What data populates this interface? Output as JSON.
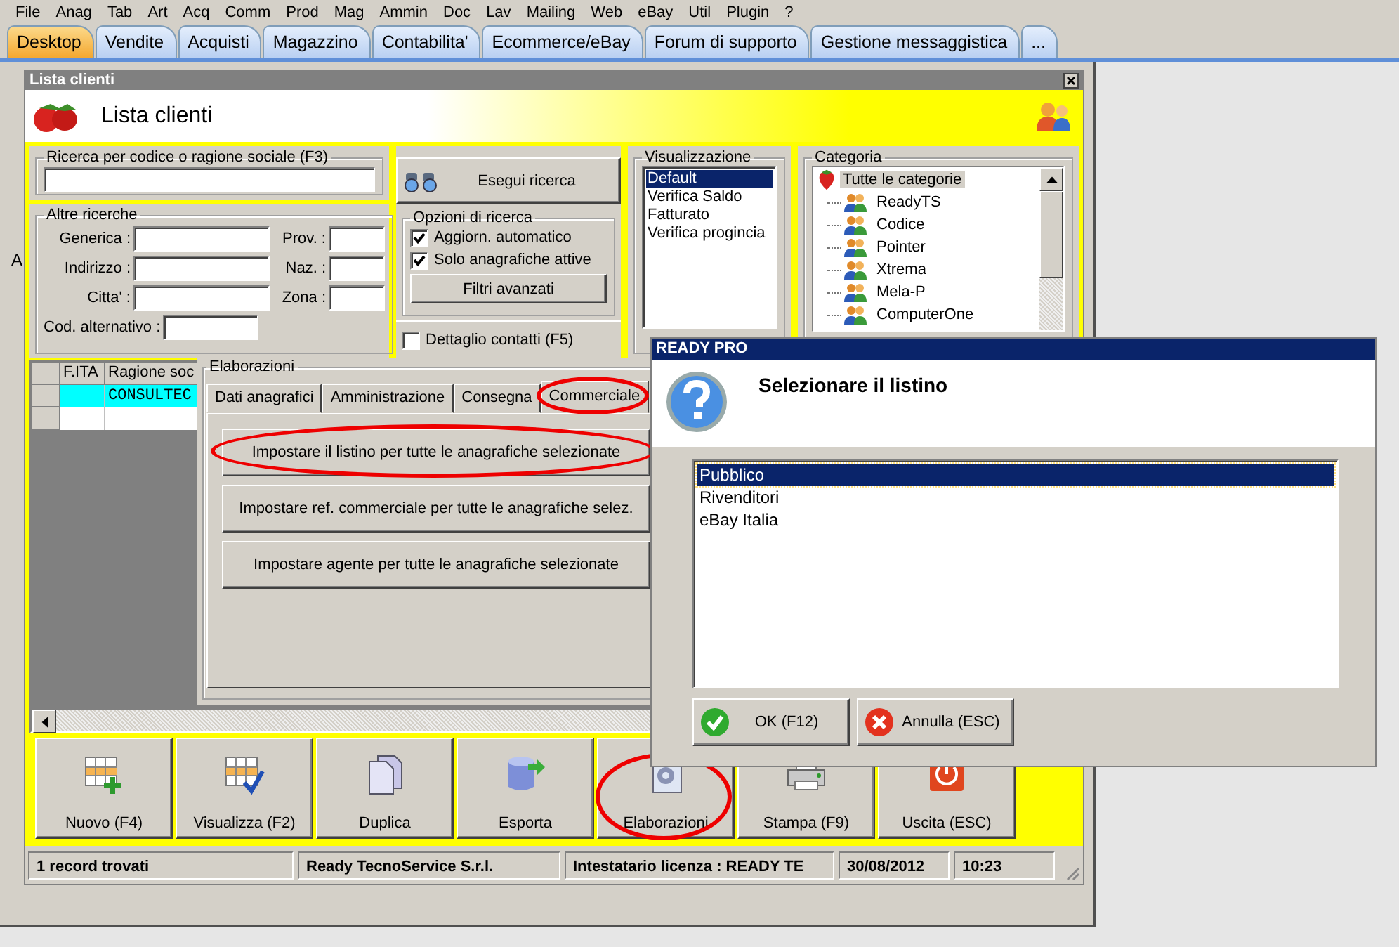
{
  "menu": [
    "File",
    "Anag",
    "Tab",
    "Art",
    "Acq",
    "Comm",
    "Prod",
    "Mag",
    "Ammin",
    "Doc",
    "Lav",
    "Mailing",
    "Web",
    "eBay",
    "Util",
    "Plugin",
    "?"
  ],
  "tabs": [
    {
      "label": "Desktop",
      "selected": true
    },
    {
      "label": "Vendite",
      "selected": false
    },
    {
      "label": "Acquisti",
      "selected": false
    },
    {
      "label": "Magazzino",
      "selected": false
    },
    {
      "label": "Contabilita'",
      "selected": false
    },
    {
      "label": "Ecommerce/eBay",
      "selected": false
    },
    {
      "label": "Forum di supporto",
      "selected": false
    },
    {
      "label": "Gestione messaggistica",
      "selected": false
    },
    {
      "label": "...",
      "selected": false
    }
  ],
  "desktop_text": "A",
  "window": {
    "title": "Lista clienti",
    "heading": "Lista clienti",
    "search": {
      "label": "Ricerca per codice o ragione sociale (F3)"
    },
    "search_button": "Esegui ricerca",
    "other_searches": {
      "label": "Altre ricerche",
      "left_fields": [
        "Generica :",
        "Indirizzo :",
        "Citta' :"
      ],
      "right_fields": [
        "Prov. :",
        "Naz. :",
        "Zona :"
      ],
      "alt_code_field": "Cod. alternativo :"
    },
    "options": {
      "label": "Opzioni di ricerca",
      "checkboxes": [
        {
          "label": "Aggiorn. automatico",
          "checked": true
        },
        {
          "label": "Solo anagrafiche attive",
          "checked": true
        }
      ],
      "filter_button": "Filtri avanzati"
    },
    "contact_detail": {
      "label": "Dettaglio contatti (F5)",
      "checked": false
    },
    "view": {
      "label": "Visualizzazione",
      "items": [
        {
          "label": "Default",
          "selected": true
        },
        {
          "label": "Verifica Saldo",
          "selected": false
        },
        {
          "label": "Fatturato",
          "selected": false
        },
        {
          "label": "Verifica progincia",
          "selected": false
        }
      ]
    },
    "category": {
      "label": "Categoria",
      "tree": [
        {
          "label": "Tutte le categorie",
          "selected": true,
          "children": [
            {
              "label": "ReadyTS",
              "selected": false
            },
            {
              "label": "Codice",
              "selected": false
            },
            {
              "label": "Pointer",
              "selected": false
            },
            {
              "label": "Xtrema",
              "selected": false
            },
            {
              "label": "Mela-P",
              "selected": false
            },
            {
              "label": "ComputerOne",
              "selected": false
            }
          ]
        }
      ]
    },
    "table": {
      "columns": [
        "F.ITA",
        "Ragione soc"
      ],
      "rows": [
        {
          "selected": true,
          "column_2": "CONSULTEC"
        },
        {
          "selected": false
        }
      ]
    },
    "toolbar": [
      {
        "label": "Nuovo (F4)",
        "highlighted": false
      },
      {
        "label": "Visualizza (F2)",
        "highlighted": false
      },
      {
        "label": "Duplica",
        "highlighted": false
      },
      {
        "label": "Esporta",
        "highlighted": false
      },
      {
        "label": "Elaborazioni",
        "highlighted": true
      },
      {
        "label": "Stampa (F9)",
        "highlighted": false
      },
      {
        "label": "Uscita (ESC)",
        "highlighted": false
      }
    ],
    "status_bar": [
      "1 record trovati",
      "Ready TecnoService S.r.l.",
      "Intestatario licenza : READY TE",
      "30/08/2012",
      "10:23"
    ]
  },
  "elaborazioni": {
    "title": "Elaborazioni",
    "tabs": [
      {
        "label": "Dati anagrafici",
        "selected": false,
        "highlighted": false
      },
      {
        "label": "Amministrazione",
        "selected": false,
        "highlighted": false
      },
      {
        "label": "Consegna",
        "selected": false,
        "highlighted": false
      },
      {
        "label": "Commerciale",
        "selected": true,
        "highlighted": true
      }
    ],
    "buttons": [
      {
        "label": "Impostare il listino per tutte le anagrafiche selezionate",
        "highlighted": true
      },
      {
        "label": "Impostare ref. commerciale per tutte le anagrafiche selez.",
        "highlighted": false
      },
      {
        "label": "Impostare agente per tutte le anagrafiche selezionate",
        "highlighted": false
      }
    ]
  },
  "dialog": {
    "title": "READY PRO",
    "message": "Selezionare il listino",
    "items": [
      {
        "label": "Pubblico",
        "selected": true
      },
      {
        "label": "Rivenditori",
        "selected": false
      },
      {
        "label": "eBay Italia",
        "selected": false
      }
    ],
    "buttons": [
      {
        "label": "OK (F12)",
        "kind": "ok"
      },
      {
        "label": "Annulla (ESC)",
        "kind": "cancel"
      }
    ]
  }
}
